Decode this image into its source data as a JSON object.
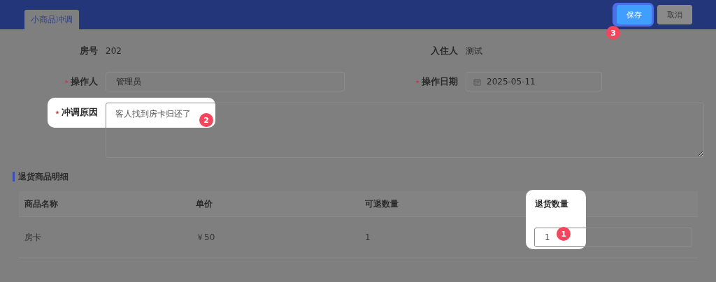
{
  "header": {
    "tab": {
      "label": "小商品冲调",
      "selected": true
    },
    "buttons": [
      {
        "label": "保存",
        "kind": "primary"
      },
      {
        "label": "取消",
        "kind": "default"
      }
    ]
  },
  "form": {
    "fields": [
      {
        "kind": "text",
        "label": "房号",
        "required": false,
        "value": "202"
      },
      {
        "kind": "text",
        "label": "入住人",
        "required": false,
        "value": "测试"
      },
      {
        "kind": "input",
        "label": "操作人",
        "required": true,
        "value": "管理员"
      },
      {
        "kind": "date",
        "label": "操作日期",
        "required": true,
        "value": "2025-05-11"
      },
      {
        "kind": "textarea",
        "label": "冲调原因",
        "required": true,
        "value": "客人找到房卡归还了"
      }
    ]
  },
  "section_title": "退货商品明细",
  "table": {
    "columns": [
      "商品名称",
      "单价",
      "可退数量",
      "退货数量"
    ],
    "rows": [
      {
        "cells": [
          "房卡",
          "￥50",
          "1"
        ],
        "quantity": "1"
      }
    ]
  },
  "guide_steps": [
    {
      "number": "1"
    },
    {
      "number": "2"
    },
    {
      "number": "3"
    }
  ]
}
